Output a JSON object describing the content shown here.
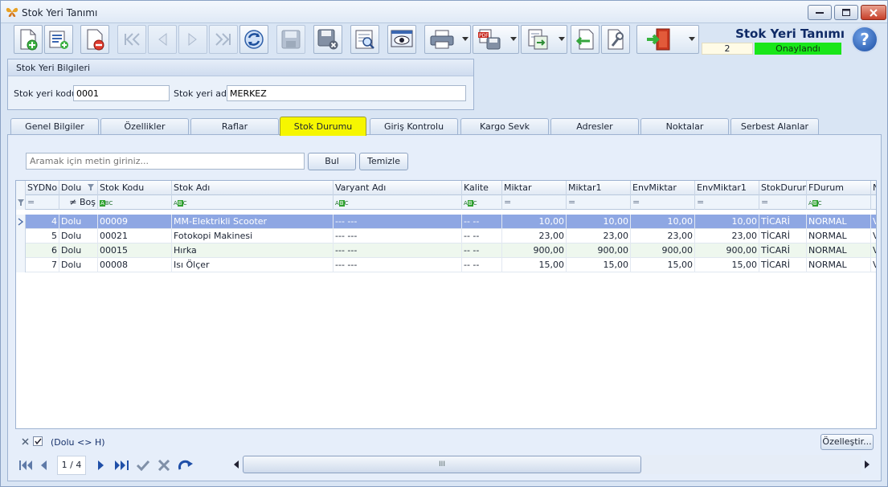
{
  "window": {
    "title": "Stok Yeri Tanımı",
    "controls": {
      "minimize": "minimize",
      "maximize": "maximize",
      "close": "close"
    }
  },
  "header": {
    "app_title": "Stok Yeri Tanımı",
    "record_no": "2",
    "status": "Onaylandı",
    "status_color": "#19e619"
  },
  "toolbar_icons": [
    "new-document-icon",
    "add-list-icon",
    "delete-icon",
    "first-record-icon",
    "previous-record-icon",
    "next-record-icon",
    "last-record-icon",
    "refresh-icon",
    "save-icon",
    "save-close-icon",
    "preview-icon",
    "view-icon",
    "print-icon",
    "export-pdf-icon",
    "transfer-icon",
    "import-icon",
    "tools-icon",
    "exit-icon",
    "help-icon"
  ],
  "group": {
    "title": "Stok Yeri Bilgileri",
    "code_label": "Stok yeri kodu",
    "code_value": "0001",
    "name_label": "Stok yeri adı",
    "name_value": "MERKEZ"
  },
  "tabs": [
    {
      "label": "Genel Bilgiler"
    },
    {
      "label": "Özellikler"
    },
    {
      "label": "Raflar"
    },
    {
      "label": "Stok Durumu",
      "active": true
    },
    {
      "label": "Giriş Kontrolu"
    },
    {
      "label": "Kargo Sevk"
    },
    {
      "label": "Adresler"
    },
    {
      "label": "Noktalar"
    },
    {
      "label": "Serbest Alanlar"
    }
  ],
  "search": {
    "placeholder": "Aramak için metin giriniz...",
    "find_label": "Bul",
    "clear_label": "Temizle"
  },
  "grid": {
    "columns": [
      "SYDNo",
      "Dolu",
      "Stok Kodu",
      "Stok Adı",
      "Varyant Adı",
      "Kalite",
      "Miktar",
      "Miktar1",
      "EnvMiktar",
      "EnvMiktar1",
      "StokDurum",
      "FDurum",
      "N"
    ],
    "filter_row": {
      "dolu": "≠  Boş",
      "eq": "="
    },
    "rows": [
      {
        "sydno": "4",
        "dolu": "Dolu",
        "kod": "00009",
        "ad": "MM-Elektrikli Scooter",
        "varyant": "--- ---",
        "kalite": "-- --",
        "miktar": "10,00",
        "miktar1": "10,00",
        "env": "10,00",
        "env1": "10,00",
        "stokdurum": "TİCARİ",
        "fdurum": "NORMAL",
        "n": "V"
      },
      {
        "sydno": "5",
        "dolu": "Dolu",
        "kod": "00021",
        "ad": "Fotokopi Makinesi",
        "varyant": "--- ---",
        "kalite": "-- --",
        "miktar": "23,00",
        "miktar1": "23,00",
        "env": "23,00",
        "env1": "23,00",
        "stokdurum": "TİCARİ",
        "fdurum": "NORMAL",
        "n": "V"
      },
      {
        "sydno": "6",
        "dolu": "Dolu",
        "kod": "00015",
        "ad": "Hırka",
        "varyant": "--- ---",
        "kalite": "-- --",
        "miktar": "900,00",
        "miktar1": "900,00",
        "env": "900,00",
        "env1": "900,00",
        "stokdurum": "TİCARİ",
        "fdurum": "NORMAL",
        "n": "V"
      },
      {
        "sydno": "7",
        "dolu": "Dolu",
        "kod": "00008",
        "ad": "Isı Ölçer",
        "varyant": "--- ---",
        "kalite": "-- --",
        "miktar": "15,00",
        "miktar1": "15,00",
        "env": "15,00",
        "env1": "15,00",
        "stokdurum": "TİCARİ",
        "fdurum": "NORMAL",
        "n": "V"
      }
    ]
  },
  "filter_panel": {
    "text": "(Dolu <> H)",
    "customize_label": "Özelleştir..."
  },
  "navigator": {
    "page": "1 / 4",
    "scroll_grip": "III"
  },
  "colors": {
    "active_tab": "#f6f600",
    "selected_row": "#8ea7e3",
    "title_blue": "#0f2a66"
  }
}
